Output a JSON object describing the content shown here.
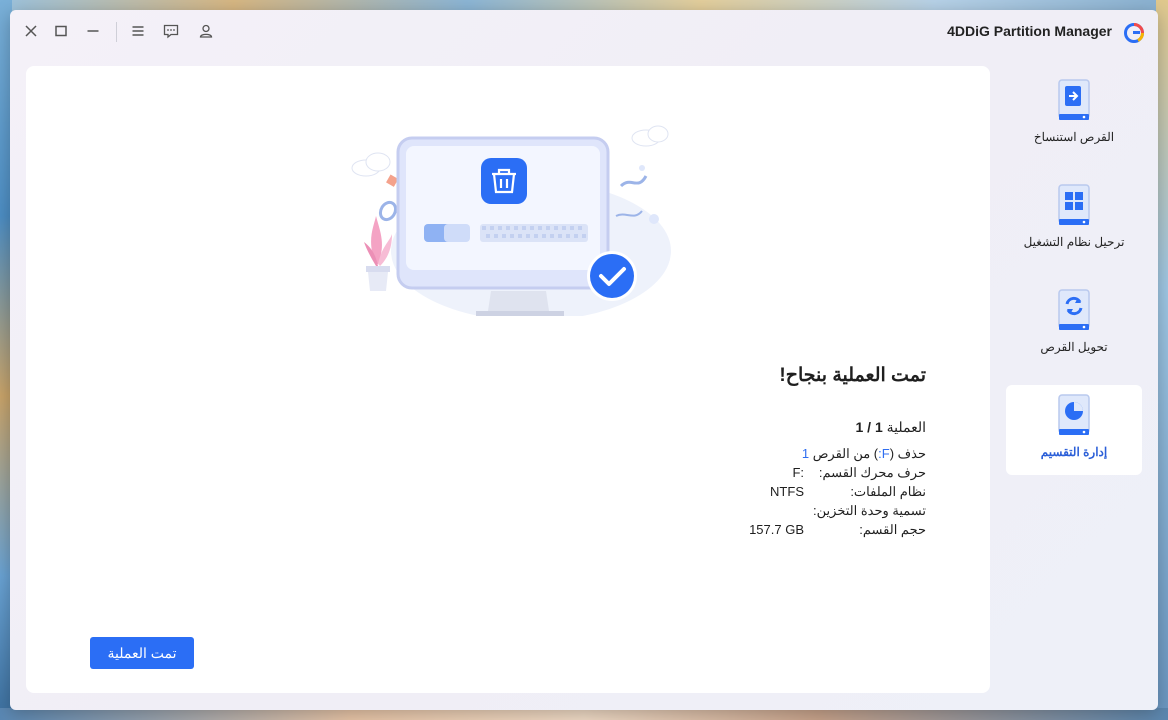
{
  "app": {
    "title": "4DDiG Partition Manager"
  },
  "window_controls": [
    "close-icon",
    "maximize-icon",
    "minimize-icon",
    "menu-icon",
    "feedback-icon",
    "account-icon"
  ],
  "sidebar": {
    "items": [
      {
        "label": "القرص استنساخ",
        "icon": "disk-clone-icon",
        "active": false
      },
      {
        "label": "ترحيل نظام التشغيل",
        "icon": "os-migration-icon",
        "active": false
      },
      {
        "label": "تحويل القرص",
        "icon": "disk-convert-icon",
        "active": false
      },
      {
        "label": "إدارة التقسيم",
        "icon": "partition-manage-icon",
        "active": true
      }
    ]
  },
  "result": {
    "title": "تمت العملية بنجاح!",
    "op_label": "العملية",
    "op_count": "1 / 1",
    "action_prefix": "حذف (",
    "action_drive": "F:",
    "action_middle": ") من القرص",
    "action_disk": "1",
    "details": [
      {
        "key": "حرف محرك القسم:",
        "value": "F:"
      },
      {
        "key": "نظام الملفات:",
        "value": "NTFS"
      },
      {
        "key": "تسمية وحدة التخزين:",
        "value": ""
      },
      {
        "key": "حجم القسم:",
        "value": "157.7 GB"
      }
    ]
  },
  "done_button": {
    "label": "تمت العملية"
  },
  "colors": {
    "accent": "#2b6ef5",
    "link": "#2f6ef0",
    "success": "#2b6ef5"
  }
}
